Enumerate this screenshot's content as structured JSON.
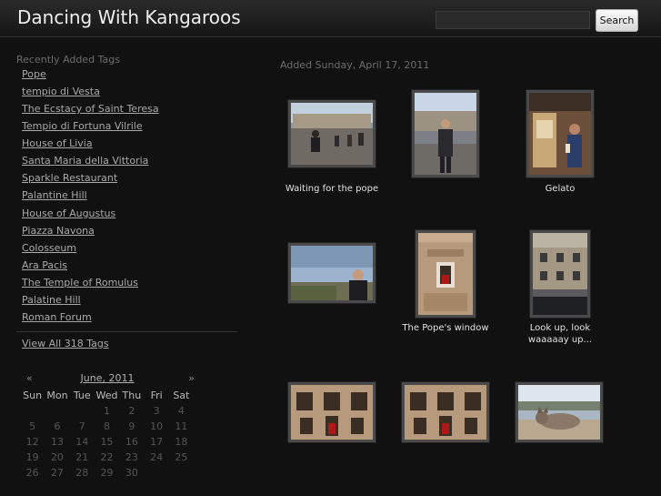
{
  "header": {
    "title": "Dancing With Kangaroos",
    "search_placeholder": "",
    "search_button": "Search"
  },
  "sidebar": {
    "heading": "Recently Added Tags",
    "tags": [
      "Pope",
      "tempio di Vesta",
      "The Ecstacy of Saint Teresa",
      "Tempio di Fortuna Vilrile",
      "House of Livia",
      "Santa Maria della Vittoria",
      "Sparkle Restaurant",
      "Palantine Hill",
      "House of Augustus",
      "Piazza Navona",
      "Colosseum",
      "Ara Pacis",
      "The Temple of Romulus",
      "Palatine Hill",
      "Roman Forum"
    ],
    "view_all": "View All 318 Tags"
  },
  "calendar": {
    "prev": "«",
    "next": "»",
    "month": "June, 2011",
    "weekdays": [
      "Sun",
      "Mon",
      "Tue",
      "Wed",
      "Thu",
      "Fri",
      "Sat"
    ],
    "days": [
      "",
      "",
      "",
      "1",
      "2",
      "3",
      "4",
      "5",
      "6",
      "7",
      "8",
      "9",
      "10",
      "11",
      "12",
      "13",
      "14",
      "15",
      "16",
      "17",
      "18",
      "19",
      "20",
      "21",
      "22",
      "23",
      "24",
      "25",
      "26",
      "27",
      "28",
      "29",
      "30",
      "",
      ""
    ]
  },
  "main": {
    "date_heading": "Added Sunday, April 17, 2011",
    "photos": [
      {
        "caption": "Waiting for the pope",
        "scene": "square"
      },
      {
        "caption": "",
        "scene": "man-street"
      },
      {
        "caption": "Gelato",
        "scene": "gelato"
      },
      {
        "caption": "",
        "scene": "man-sky"
      },
      {
        "caption": "The Pope's window",
        "scene": "window"
      },
      {
        "caption": "Look up, look waaaaay up...",
        "scene": "facade"
      },
      {
        "caption": "",
        "scene": "window-wide"
      },
      {
        "caption": "",
        "scene": "window-wide"
      },
      {
        "caption": "",
        "scene": "cat"
      }
    ]
  }
}
